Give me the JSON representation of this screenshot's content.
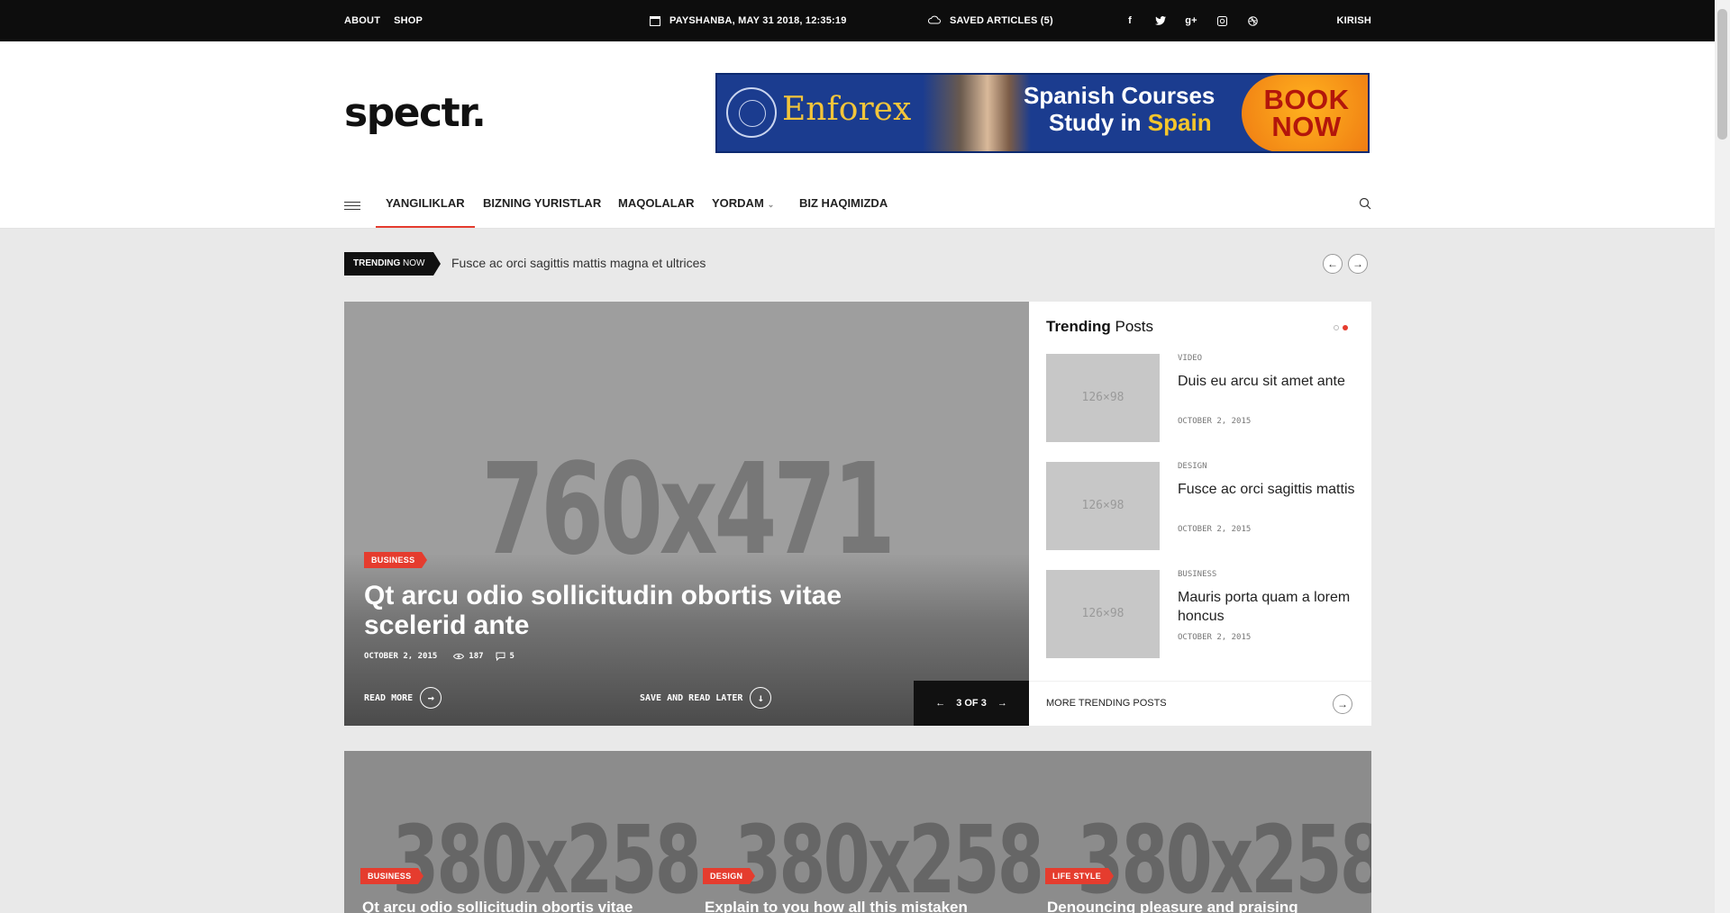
{
  "topbar": {
    "about": "ABOUT",
    "shop": "SHOP",
    "datetime": "PAYSHANBA, MAY 31 2018, 12:35:19",
    "saved": "SAVED ARTICLES (5)",
    "social": [
      "facebook-icon",
      "twitter-icon",
      "google-plus-icon",
      "instagram-icon",
      "dribbble-icon"
    ],
    "login": "KIRISH"
  },
  "header": {
    "logo": "spectr.",
    "ad": {
      "brand": "Enforex",
      "line1": "Spanish Courses",
      "line2_a": "Study in ",
      "line2_b": "Spain",
      "cta_1": "BOOK",
      "cta_2": "NOW"
    }
  },
  "nav": {
    "items": [
      "YANGILIKLAR",
      "BIZNING YURISTLAR",
      "MAQOLALAR",
      "YORDAM",
      "BIZ HAQIMIZDA"
    ],
    "active_index": 0
  },
  "trending_bar": {
    "label_bold": "TRENDING",
    "label_rest": " NOW",
    "headline": "Fusce ac orci sagittis mattis magna et ultrices"
  },
  "hero": {
    "placeholder": "760x471",
    "category": "BUSINESS",
    "title": "Qt arcu odio sollicitudin obortis vitae scelerid ante",
    "date": "OCTOBER 2, 2015",
    "views": "187",
    "comments": "5",
    "read_more": "READ MORE",
    "save_later": "SAVE AND READ LATER",
    "pager": "3 OF 3"
  },
  "sidebar": {
    "title_bold": "Trending",
    "title_rest": " Posts",
    "posts": [
      {
        "thumb": "126×98",
        "category": "VIDEO",
        "title": "Duis eu arcu sit amet ante",
        "date": "OCTOBER 2, 2015"
      },
      {
        "thumb": "126×98",
        "category": "DESIGN",
        "title": "Fusce ac orci sagittis mattis",
        "date": "OCTOBER 2, 2015"
      },
      {
        "thumb": "126×98",
        "category": "BUSINESS",
        "title": "Mauris porta quam a lorem honcus",
        "date": "OCTOBER 2, 2015"
      }
    ],
    "more": "MORE TRENDING POSTS"
  },
  "grid": {
    "cards": [
      {
        "placeholder": "380x258",
        "category": "BUSINESS",
        "title": "Qt arcu odio sollicitudin obortis vitae"
      },
      {
        "placeholder": "380x258",
        "category": "DESIGN",
        "title": "Explain to you how all this mistaken"
      },
      {
        "placeholder": "380x258",
        "category": "LIFE STYLE",
        "title": "Denouncing pleasure and praising"
      }
    ]
  },
  "colors": {
    "accent": "#e53c2e",
    "topbar": "#0d0d0d"
  }
}
